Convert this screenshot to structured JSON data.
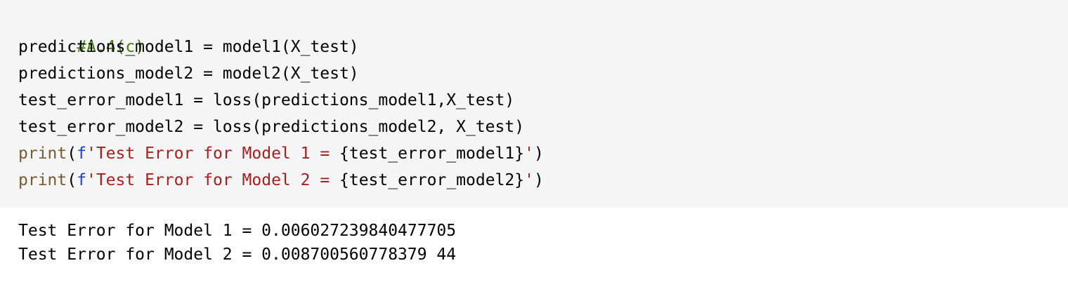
{
  "cell": {
    "input": {
      "comment": "#A.4(c)",
      "line1": "predictions_model1 = model1(X_test)",
      "line2": "predictions_model2 = model2(X_test)",
      "line3": "test_error_model1 = loss(predictions_model1,X_test)",
      "line4": "test_error_model2 = loss(predictions_model2, X_test)",
      "print1": {
        "func": "print",
        "open": "(",
        "prefix": "f",
        "str_open": "'",
        "str_text": "Test Error for Model 1 = ",
        "expr": "{test_error_model1}",
        "str_close": "'",
        "close": ")"
      },
      "print2": {
        "func": "print",
        "open": "(",
        "prefix": "f",
        "str_open": "'",
        "str_text": "Test Error for Model 2 = ",
        "expr": "{test_error_model2}",
        "str_close": "'",
        "close": ")"
      }
    },
    "output": {
      "line1": "Test Error for Model 1 = 0.006027239840477705",
      "line2": "Test Error for Model 2 = 0.008700560778379 44"
    }
  },
  "colors": {
    "input_background": "#f5f5f5",
    "comment": "#408010",
    "builtin": "#7a5b2f",
    "string_prefix": "#1f3fd0",
    "string": "#a81f1f"
  }
}
